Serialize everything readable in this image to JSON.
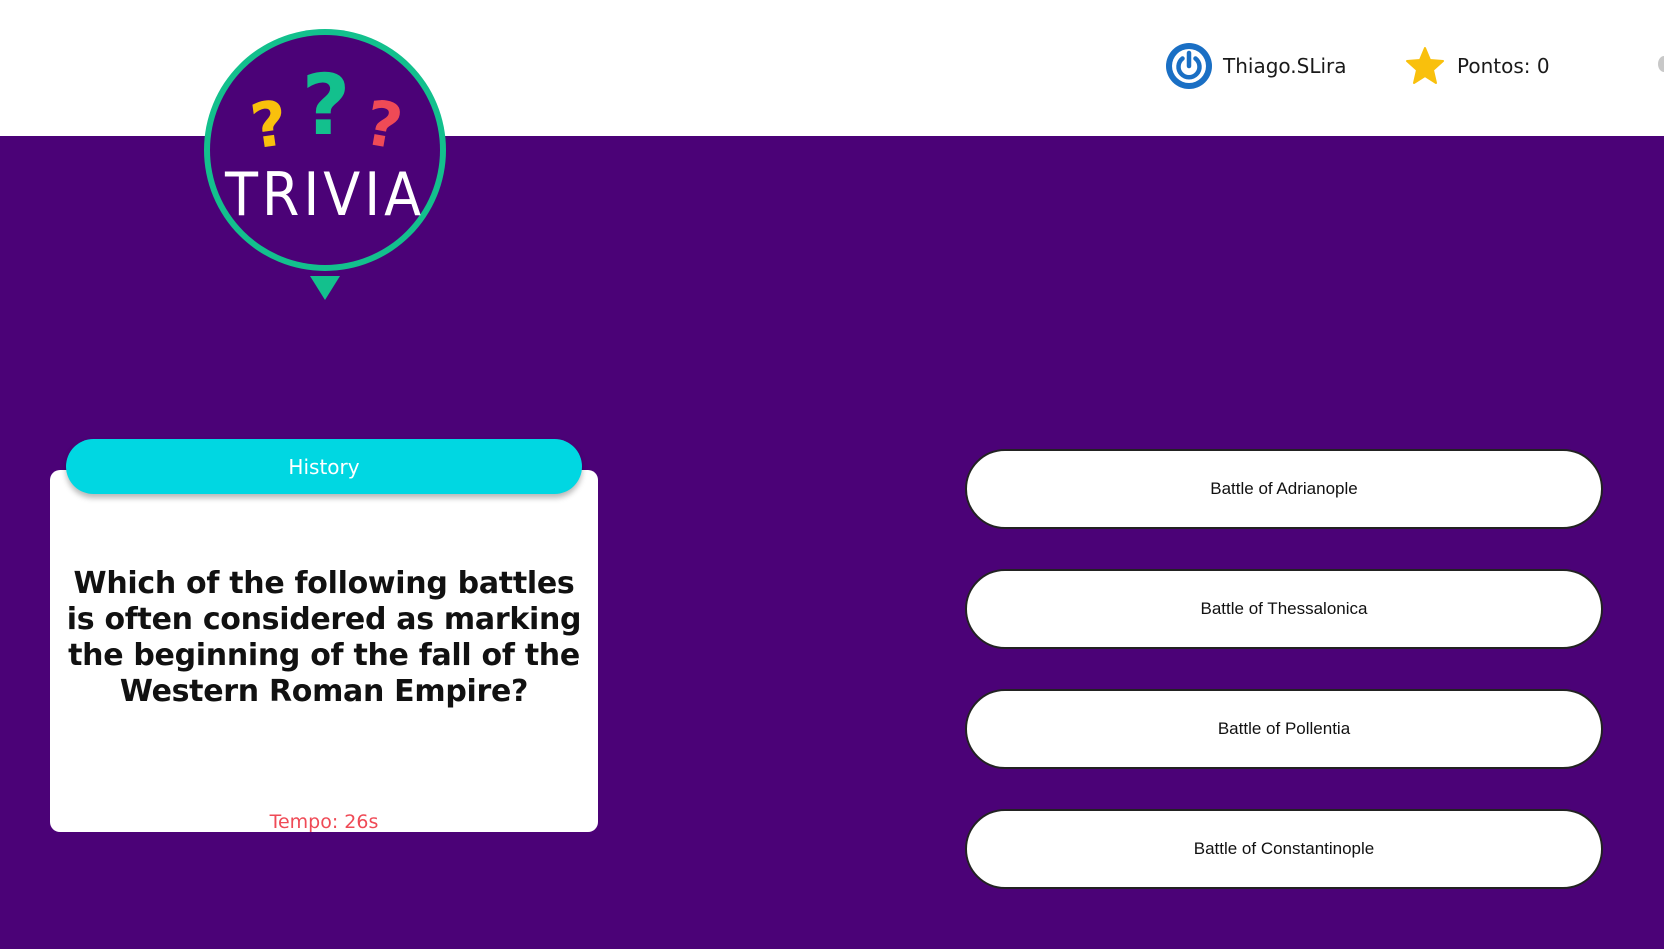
{
  "header": {
    "username": "Thiago.SLira",
    "score_label": "Pontos: 0",
    "avatar_icon": "power-icon",
    "score_icon": "star-icon"
  },
  "logo": {
    "text": "TRIVIA",
    "colors": {
      "ring": "#13c08d",
      "circle": "#4b0277",
      "q_yellow": "#f9c00c",
      "q_green": "#13c08d",
      "q_red": "#ef4a56"
    }
  },
  "question_card": {
    "category": "History",
    "question": "Which of the following battles is often considered as marking the beginning of the fall of the Western Roman Empire?",
    "timer": "Tempo: 26s"
  },
  "answers": [
    {
      "label": "Battle of Adrianople"
    },
    {
      "label": "Battle of Thessalonica"
    },
    {
      "label": "Battle of Pollentia"
    },
    {
      "label": "Battle of Constantinople"
    }
  ],
  "colors": {
    "background": "#4b0277",
    "header": "#ffffff",
    "category_pill": "#00d7e2",
    "timer": "#ef4a56",
    "avatar": "#1a6fc4",
    "star": "#f9c00c"
  }
}
